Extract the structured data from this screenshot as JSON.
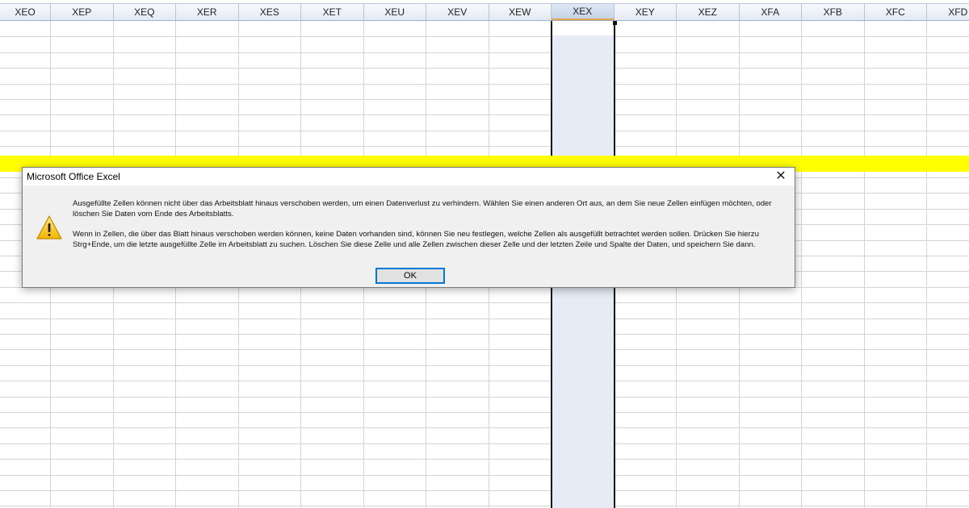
{
  "spreadsheet": {
    "columns": [
      "XEO",
      "XEP",
      "XEQ",
      "XER",
      "XES",
      "XET",
      "XEU",
      "XEV",
      "XEW",
      "XEX",
      "XEY",
      "XEZ",
      "XFA",
      "XFB",
      "XFC",
      "XFD"
    ],
    "selected_column": "XEX",
    "highlight_color": "#ffff00",
    "selection_color": "#e6ebf5"
  },
  "dialog": {
    "title": "Microsoft Office Excel",
    "icon": "warning-icon",
    "message_1": "Ausgefüllte Zellen können nicht über das Arbeitsblatt hinaus verschoben werden, um einen Datenverlust zu verhindern. Wählen Sie einen anderen Ort aus, an dem Sie neue Zellen einfügen möchten, oder löschen Sie Daten vom Ende des Arbeitsblatts.",
    "message_2": "Wenn in Zellen, die über das Blatt hinaus verschoben werden können, keine Daten vorhanden sind, können Sie neu festlegen, welche Zellen als ausgefüllt betrachtet werden sollen. Drücken Sie hierzu Strg+Ende, um die letzte ausgefüllte Zelle im Arbeitsblatt zu suchen. Löschen Sie diese Zelle und alle Zellen zwischen dieser Zelle und der letzten Zeile und Spalte der Daten, und speichern Sie dann.",
    "ok_label": "OK",
    "close_glyph": "✕"
  }
}
